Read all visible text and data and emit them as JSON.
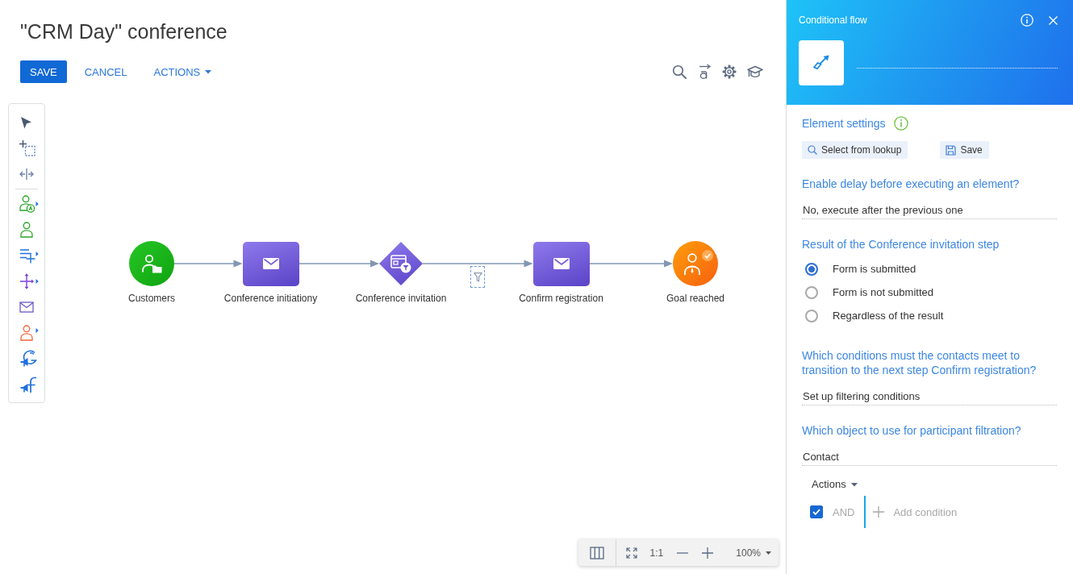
{
  "page": {
    "title": "\"CRM Day\" conference"
  },
  "toolbar": {
    "buttons": [
      {
        "label": "SAVE",
        "kind": "primary"
      },
      {
        "label": "CANCEL",
        "kind": "link"
      },
      {
        "label": "ACTIONS",
        "kind": "menu"
      }
    ]
  },
  "diagram": {
    "nodes": [
      {
        "label": "Customers",
        "kind": "audience"
      },
      {
        "label": "Conference initiationy",
        "kind": "email"
      },
      {
        "label": "Conference invitation",
        "kind": "landing"
      },
      {
        "label": "Confirm registration",
        "kind": "email"
      },
      {
        "label": "Goal reached",
        "kind": "goal"
      }
    ],
    "connectors": [
      {
        "kind": "plain",
        "selected": false
      },
      {
        "kind": "plain",
        "selected": false
      },
      {
        "kind": "conditional",
        "selected": true
      },
      {
        "kind": "plain",
        "selected": false
      }
    ]
  },
  "zoom_bar": {
    "actual_size": "1:1",
    "zoom": "100%"
  },
  "panel": {
    "title": "Conditional flow",
    "settings": {
      "heading": "Element settings",
      "buttons": [
        {
          "label": "Select from lookup",
          "kind": "lookup"
        },
        {
          "label": "Save",
          "kind": "save"
        }
      ]
    },
    "sections": [
      {
        "kind": "select",
        "question": "Enable delay before executing an element?",
        "value": "No, execute after the previous one"
      },
      {
        "kind": "radio",
        "question": "Result of the Conference invitation step",
        "options": [
          {
            "label": "Form is submitted",
            "selected": true
          },
          {
            "label": "Form is not submitted",
            "selected": false
          },
          {
            "label": "Regardless of the result",
            "selected": false
          }
        ]
      },
      {
        "kind": "select",
        "question": "Which conditions must the contacts meet to transition to the next step Confirm registration?",
        "value": "Set up filtering conditions"
      },
      {
        "kind": "select",
        "question": "Which object to use for participant filtration?",
        "value": "Contact"
      }
    ],
    "filter": {
      "menu": "Actions",
      "group": {
        "checked": true,
        "operator": "AND"
      },
      "add_label": "Add condition"
    }
  }
}
